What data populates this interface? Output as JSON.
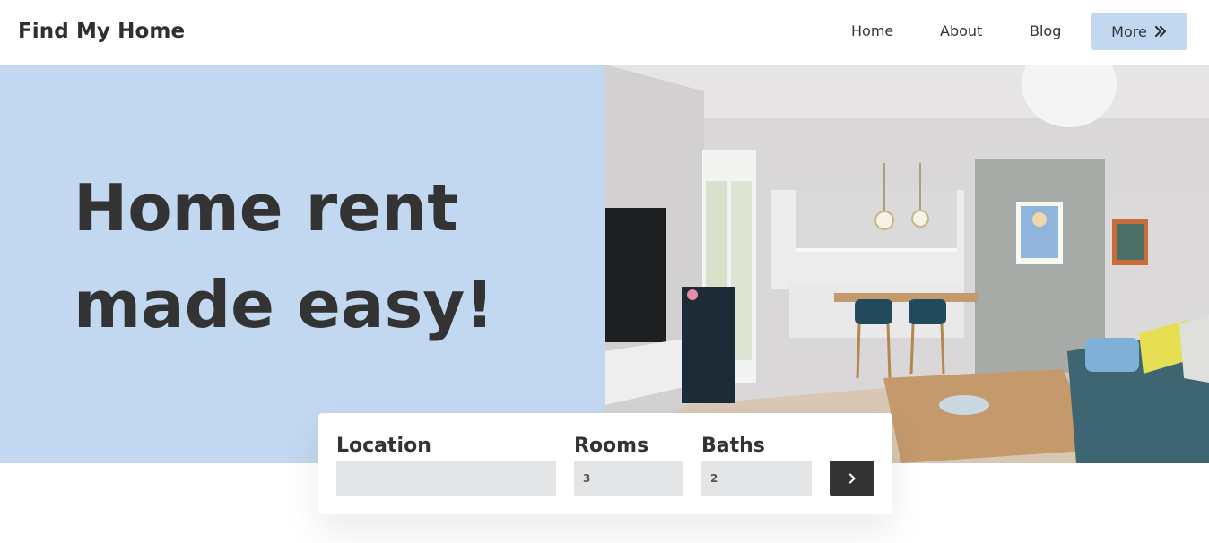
{
  "brand": {
    "name": "Find My Home"
  },
  "nav": {
    "links": [
      {
        "label": "Home"
      },
      {
        "label": "About"
      },
      {
        "label": "Blog"
      }
    ],
    "more_label": "More"
  },
  "hero": {
    "headline_line1": "Home rent",
    "headline_line2": "made easy!"
  },
  "search": {
    "location_label": "Location",
    "location_value": "",
    "rooms_label": "Rooms",
    "rooms_value": "3",
    "baths_label": "Baths",
    "baths_value": "2"
  },
  "colors": {
    "hero_bg": "#c2d8f0",
    "text_dark": "#333333",
    "input_bg": "#e4e5e6",
    "button_dark": "#333333"
  },
  "icons": {
    "more": "double-chevron-right-icon",
    "submit": "chevron-right-icon"
  }
}
